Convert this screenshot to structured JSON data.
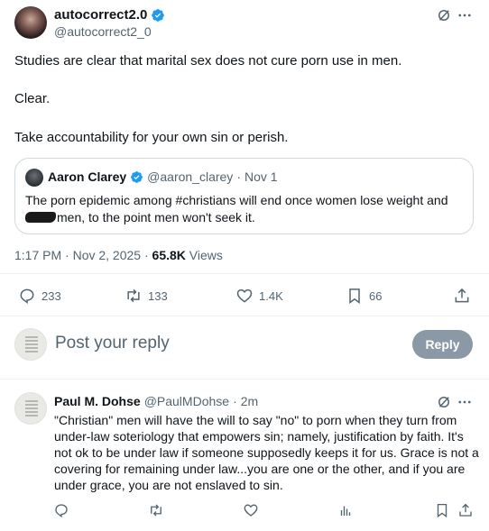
{
  "post": {
    "author_name": "autocorrect2.0",
    "author_handle": "@autocorrect2_0",
    "text_lines": [
      "Studies are clear that marital sex does not cure porn use in men.",
      "Clear.",
      "Take accountability for your own sin or perish."
    ],
    "timestamp": "1:17 PM · Nov 2, 2025 · ",
    "views_count": "65.8K",
    "views_label": " Views"
  },
  "quote": {
    "author_name": "Aaron Clarey",
    "author_handle": "@aaron_clarey",
    "date": "Nov 1",
    "separator": "·",
    "line1": "The porn epidemic among #christians will end once women lose weight and",
    "line2": "men, to the point men won't seek it."
  },
  "actions": {
    "replies": "233",
    "reposts": "133",
    "likes": "1.4K",
    "bookmarks": "66"
  },
  "composer": {
    "placeholder": "Post your reply",
    "button_label": "Reply"
  },
  "reply": {
    "author_name": "Paul M. Dohse",
    "author_handle": "@PaulMDohse",
    "separator": "·",
    "time": "2m",
    "lines": [
      "\"Christian\" men will have the will to say \"no\" to porn when they turn from",
      "under-law soteriology that empowers sin; namely, justification by faith. It's",
      "not ok to be under law if someone supposedly keeps it for us. Grace is not a",
      "covering for remaining under law...you are one or the other, and if you are",
      "under grace, you are not enslaved to sin."
    ]
  },
  "colors": {
    "verified": "#1d9bf0",
    "muted": "#536471",
    "border": "#cfd9de",
    "reply_button": "#8b98a5"
  },
  "icons": [
    "verified-badge-icon",
    "grok-icon",
    "more-icon",
    "reply-icon",
    "repost-icon",
    "like-icon",
    "bookmark-icon",
    "share-icon",
    "analytics-icon"
  ]
}
